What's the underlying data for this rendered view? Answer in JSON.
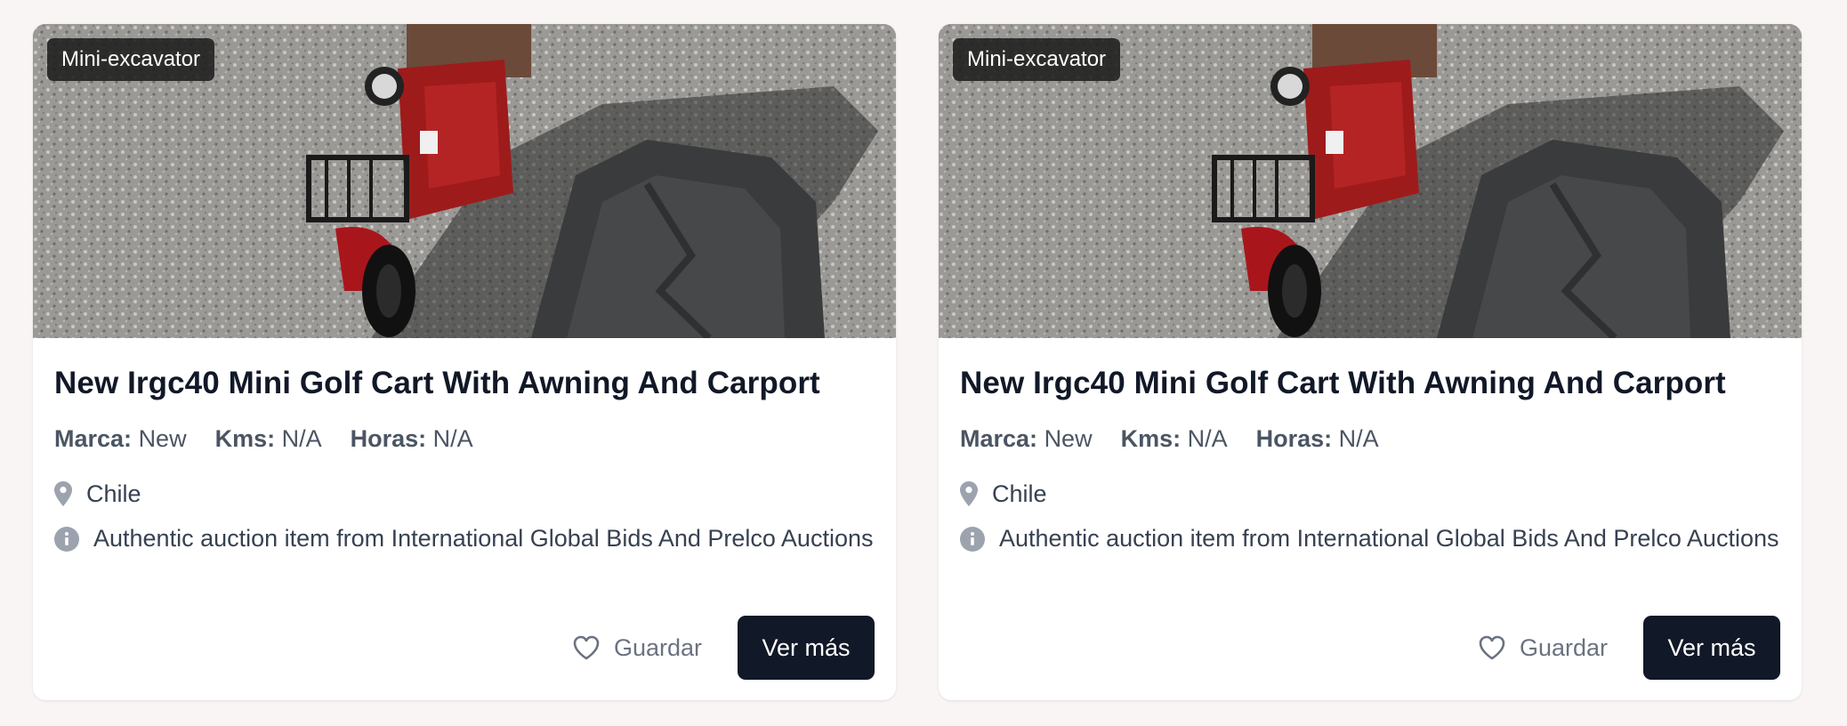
{
  "listings": [
    {
      "category_badge": "Mini-excavator",
      "title": "New Irgc40 Mini Golf Cart With Awning And Carport",
      "specs": {
        "marca_label": "Marca:",
        "marca_value": "New",
        "kms_label": "Kms:",
        "kms_value": "N/A",
        "horas_label": "Horas:",
        "horas_value": "N/A"
      },
      "location": "Chile",
      "description": "Authentic auction item from International Global Bids And Prelco Auctions",
      "save_label": "Guardar",
      "more_label": "Ver más"
    },
    {
      "category_badge": "Mini-excavator",
      "title": "New Irgc40 Mini Golf Cart With Awning And Carport",
      "specs": {
        "marca_label": "Marca:",
        "marca_value": "New",
        "kms_label": "Kms:",
        "kms_value": "N/A",
        "horas_label": "Horas:",
        "horas_value": "N/A"
      },
      "location": "Chile",
      "description": "Authentic auction item from International Global Bids And Prelco Auctions",
      "save_label": "Guardar",
      "more_label": "Ver más"
    }
  ],
  "icons": {
    "location": "map-pin-icon",
    "info": "info-icon",
    "save": "heart-icon"
  },
  "colors": {
    "button_bg": "#111827",
    "badge_bg": "#1c1c1c",
    "page_bg": "#f8f5f4"
  }
}
